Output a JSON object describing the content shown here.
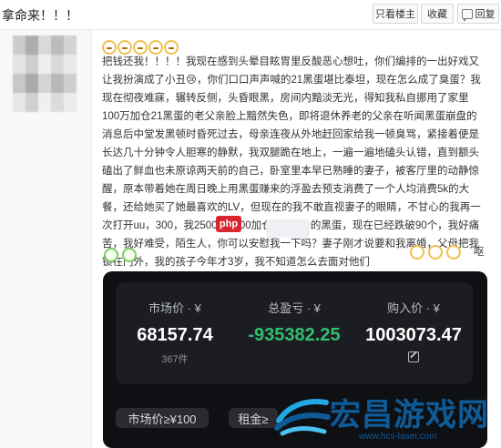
{
  "header": {
    "title": "拿命来！！！",
    "buttons": {
      "only_op": "只看楼主",
      "favorite": "收藏",
      "reply": "回复"
    }
  },
  "post": {
    "top_emojis": [
      "smile",
      "smile",
      "smile",
      "smile",
      "smile"
    ],
    "text_main": "把钱还我！！！！我现在感到头晕目眩胃里反酸恶心想吐，你们编排的一出好戏又让我扮演成了小丑😢，你们口口声声喊的21黑蛋堪比泰坦，现在怎么成了臭蛋？我现在彻夜难寐，辗转反侧，头昏眼黑，房间内黯淡无光，得知我私自挪用了家里100万加仓21黑蛋的老父亲脸上黯然失色，即将退休养老的父亲在听闻黑蛋崩盘的消息后中堂发黑顿时昏死过去，母亲连夜从外地赶回家给我一顿臭骂，紧接着便是长达几十分钟令人胆寒的静默，我双腿跪在地上，一遍一遍地磕头认错，直到额头磕出了鲜血也未原谅两天前的自己，卧室里本早已熟睡的妻子，被客厅里的动静惊醒，原本带着她在周日晚上用黑蛋赚来的浮盈去预支消费了一个人均消费5k的大餐，还给她买了她最喜欢的LV，但现在的我不敢直视妻子的眼睛，不甘心的我再一次打开uu，300，我2500—3000加仓了300个的黑蛋，现在已经跌破90个，我好痛苦，我好难受，陌生人，你可以安慰我一下吗？妻子刚才说要和我离婚，父母把我锁在门外，我的孩子今年才3岁，我不知道怎么去面对他们",
    "tail_word": "呕",
    "watermark_badge": "php"
  },
  "card": {
    "market_value_label": "市场价 · ¥",
    "market_value": "68157.74",
    "market_count": "367件",
    "total_pnl_label": "总盈亏 · ¥",
    "total_pnl": "-935382.25",
    "buy_in_label": "购入价 · ¥",
    "buy_in": "1003073.47",
    "chips": [
      "市场价≥¥100",
      "租金≥"
    ]
  },
  "watermark": {
    "brand": "宏昌游戏网",
    "url": "www.hcs-laser.com"
  },
  "colors": {
    "profit_green": "#2fbf71",
    "card_bg": "#0f1014",
    "inner_bg": "#1c1d22",
    "watermark_blue": "#0f5b98",
    "php_red": "#d7262d"
  }
}
